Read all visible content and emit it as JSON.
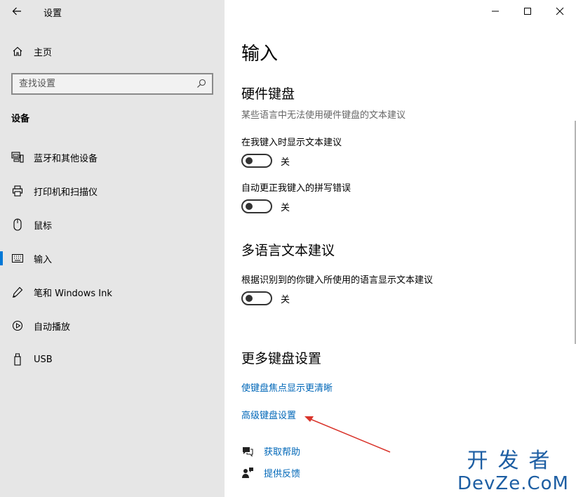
{
  "window": {
    "app_title": "设置"
  },
  "sidebar": {
    "home_label": "主页",
    "search_placeholder": "查找设置",
    "section_label": "设备",
    "items": [
      {
        "label": "蓝牙和其他设备",
        "icon": "bluetooth-devices-icon"
      },
      {
        "label": "打印机和扫描仪",
        "icon": "printer-icon"
      },
      {
        "label": "鼠标",
        "icon": "mouse-icon"
      },
      {
        "label": "输入",
        "icon": "keyboard-icon",
        "active": true
      },
      {
        "label": "笔和 Windows Ink",
        "icon": "pen-icon"
      },
      {
        "label": "自动播放",
        "icon": "autoplay-icon"
      },
      {
        "label": "USB",
        "icon": "usb-icon"
      }
    ]
  },
  "main": {
    "title": "输入",
    "hardware_keyboard": {
      "heading": "硬件键盘",
      "description": "某些语言中无法使用硬件键盘的文本建议",
      "show_suggestions_label": "在我键入时显示文本建议",
      "show_suggestions_state": "关",
      "autocorrect_label": "自动更正我键入的拼写错误",
      "autocorrect_state": "关"
    },
    "multilingual": {
      "heading": "多语言文本建议",
      "label": "根据识别到的你键入所使用的语言显示文本建议",
      "state": "关"
    },
    "more_keyboard": {
      "heading": "更多键盘设置",
      "link_focus": "使键盘焦点显示更清晰",
      "link_advanced": "高级键盘设置"
    },
    "help": {
      "get_help": "获取帮助",
      "feedback": "提供反馈"
    }
  },
  "watermark": {
    "cn": "开发者",
    "en": "DevZe.CoM"
  },
  "colors": {
    "accent": "#0078d7",
    "link": "#0067b8",
    "sidebar_bg": "#e6e6e6",
    "annotation_arrow": "#d9342b"
  }
}
